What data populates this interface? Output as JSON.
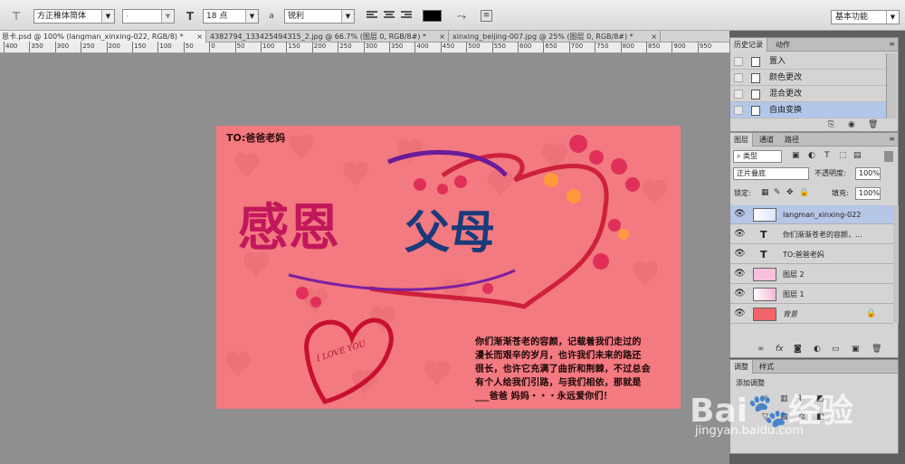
{
  "options_bar": {
    "font_family": "方正稚体简体",
    "font_style": "-",
    "font_size": "18 点",
    "aa_label": "a",
    "antialias": "锐利",
    "workspace": "基本功能"
  },
  "tabs": [
    {
      "label": "恩卡.psd @ 100% (langman_xinxing-022, RGB/8) *",
      "close": "×"
    },
    {
      "label": "4382794_133425494315_2.jpg @ 66.7% (图层 0, RGB/8#) *",
      "close": "×"
    },
    {
      "label": "xinxing_beijing-007.jpg @ 25% (图层 0, RGB/8#) *",
      "close": "×"
    }
  ],
  "ruler_labels": [
    "400",
    "350",
    "300",
    "250",
    "200",
    "150",
    "100",
    "50",
    "0",
    "50",
    "100",
    "150",
    "200",
    "250",
    "300",
    "350",
    "400",
    "450",
    "500",
    "550",
    "600",
    "650",
    "700",
    "750",
    "800",
    "850",
    "900",
    "950"
  ],
  "canvas": {
    "to_line": "TO:爸爸老妈",
    "title_left": "感恩",
    "title_right": "父母",
    "heart_text": "I LOVE YOU",
    "body_lines": [
      "你们渐渐苍老的容颜，记载着我们走过的",
      "漫长而艰辛的岁月，也许我们未来的路还",
      "很长，也许它充满了曲折和荆棘，不过总会",
      "有个人给我们引路，与我们相依，那就是",
      "___爸爸 妈妈・・・永远爱你们！"
    ]
  },
  "history_panel": {
    "tabs": [
      "历史记录",
      "动作"
    ],
    "items": [
      "置入",
      "颜色更改",
      "混合更改",
      "自由变换"
    ],
    "selected_index": 3
  },
  "layers_panel": {
    "tabs": [
      "图层",
      "通道",
      "路径"
    ],
    "filter_kind": "类型",
    "blend_mode": "正片叠底",
    "opacity_label": "不透明度:",
    "opacity_value": "100%",
    "lock_label": "锁定:",
    "fill_label": "填充:",
    "fill_value": "100%",
    "layers": [
      {
        "name": "langman_xinxing-022",
        "kind": "image",
        "selected": true
      },
      {
        "name": "你们渐渐苍老的容颜，...",
        "kind": "text",
        "selected": false
      },
      {
        "name": "TO:爸爸老妈",
        "kind": "text",
        "selected": false
      },
      {
        "name": "图层 2",
        "kind": "image",
        "selected": false
      },
      {
        "name": "图层 1",
        "kind": "image",
        "selected": false
      },
      {
        "name": "背景",
        "kind": "background",
        "selected": false
      }
    ]
  },
  "adjust_panel": {
    "tabs": [
      "调整",
      "样式"
    ],
    "add_label": "添加调整"
  },
  "watermark": {
    "brand": "Bai",
    "brand_mid": "经验",
    "url": "jingyan.baidu.com"
  },
  "colors": {
    "canvas_bg": "#f27a80",
    "selection_blue": "#b6c6e6",
    "foreground_swatch": "#000000"
  }
}
